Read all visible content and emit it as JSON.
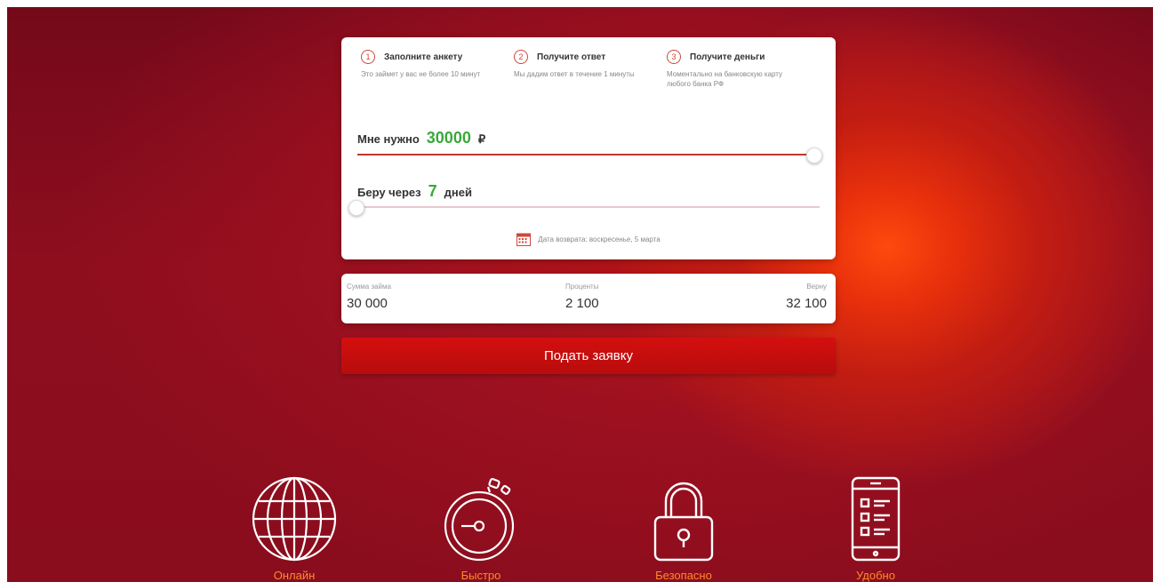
{
  "steps": [
    {
      "num": "1",
      "title": "Заполните анкету",
      "desc": "Это займет у вас не более 10 минут"
    },
    {
      "num": "2",
      "title": "Получите ответ",
      "desc": "Мы дадим ответ в течение 1 минуты"
    },
    {
      "num": "3",
      "title": "Получите деньги",
      "desc": "Моментально на банковскую карту любого банка РФ"
    }
  ],
  "amount": {
    "prefix": "Мне нужно",
    "value": "30000",
    "suffix": "₽",
    "level": 1.0
  },
  "term": {
    "prefix": "Беру через",
    "value": "7",
    "suffix": "дней",
    "level": 0.0
  },
  "return_date": "Дата возврата: воскресенье, 5 марта",
  "summary": {
    "loan_label": "Сумма займа",
    "loan_value": "30 000",
    "interest_label": "Проценты",
    "interest_value": "2 100",
    "total_label": "Верну",
    "total_value": "32 100"
  },
  "submit_label": "Подать заявку",
  "features": [
    {
      "icon": "globe-icon",
      "label": "Онлайн"
    },
    {
      "icon": "stopwatch-icon",
      "label": "Быстро"
    },
    {
      "icon": "padlock-icon",
      "label": "Безопасно"
    },
    {
      "icon": "smartphone-icon",
      "label": "Удобно"
    }
  ],
  "colors": {
    "accent": "#c0392b",
    "button": "#d40f0f",
    "value_green": "#3aa83a",
    "feature_label": "#ff8a2a"
  }
}
